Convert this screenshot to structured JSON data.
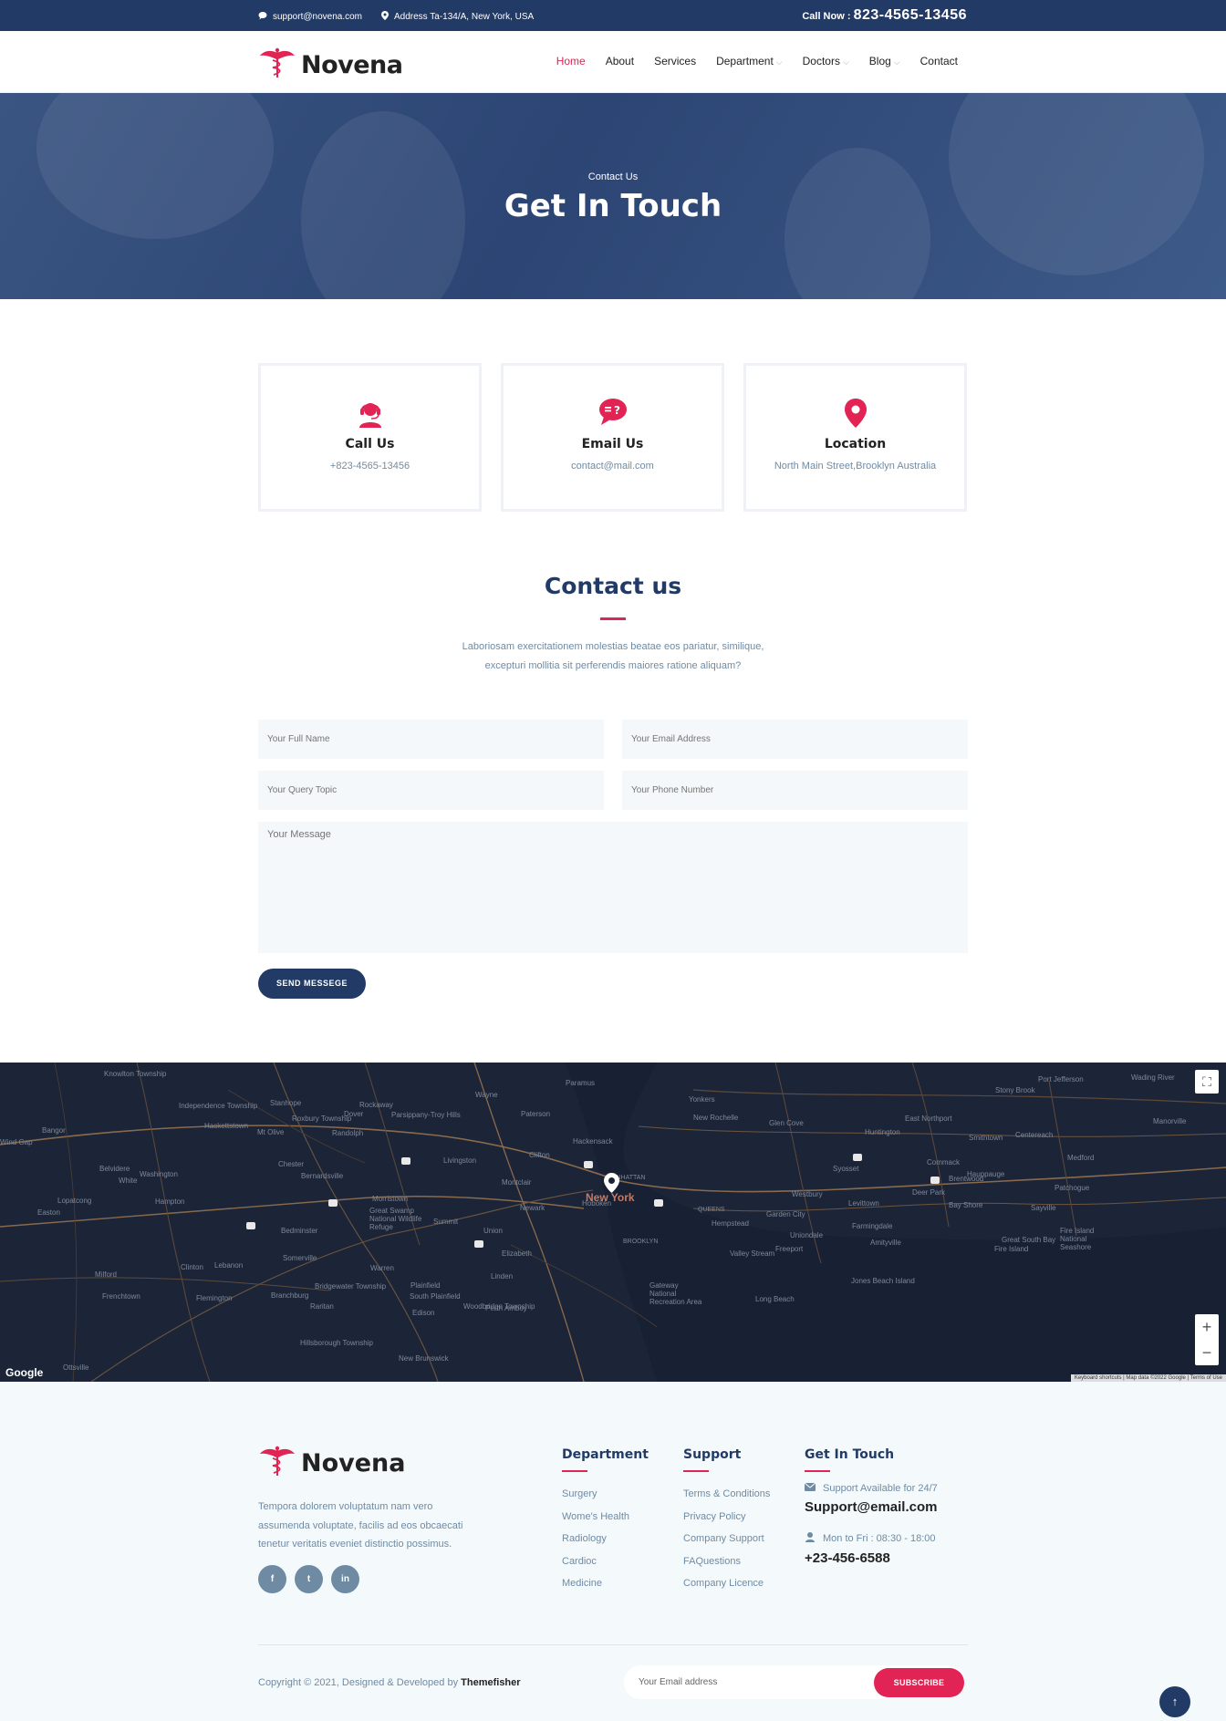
{
  "topbar": {
    "email": "support@novena.com",
    "address": "Address Ta-134/A, New York, USA",
    "call_label": "Call Now : ",
    "call_number": "823-4565-13456"
  },
  "brand": {
    "name": "Novena",
    "accent": "#e12454",
    "primary": "#223a66"
  },
  "nav": {
    "home": "Home",
    "about": "About",
    "services": "Services",
    "department": "Department",
    "doctors": "Doctors",
    "blog": "Blog",
    "contact": "Contact"
  },
  "hero": {
    "subtitle": "Contact Us",
    "title": "Get In Touch"
  },
  "cards": [
    {
      "icon": "headset-icon",
      "title": "Call Us",
      "text": "+823-4565-13456"
    },
    {
      "icon": "chat-question-icon",
      "title": "Email Us",
      "text": "contact@mail.com"
    },
    {
      "icon": "location-pin-icon",
      "title": "Location",
      "text": "North Main Street,Brooklyn Australia"
    }
  ],
  "contact": {
    "title": "Contact us",
    "desc_line1": "Laboriosam exercitationem molestias beatae eos pariatur, similique,",
    "desc_line2": "excepturi mollitia sit perferendis maiores ratione aliquam?",
    "name_placeholder": "Your Full Name",
    "email_placeholder": "Your Email Address",
    "topic_placeholder": "Your Query Topic",
    "phone_placeholder": "Your Phone Number",
    "message_placeholder": "Your Message",
    "send_label": "SEND MESSEGE"
  },
  "map": {
    "city": "New York",
    "google": "Google",
    "attribution": "Keyboard shortcuts | Map data ©2022 Google | Terms of Use",
    "labels": [
      "Yonkers",
      "New Rochelle",
      "Paterson",
      "Hackensack",
      "Clifton",
      "Montclair",
      "Morristown",
      "Newark",
      "Elizabeth",
      "Union",
      "Summit",
      "Plainfield",
      "Linden",
      "MANHATTAN",
      "QUEENS",
      "BROOKLYN",
      "Hempstead",
      "Garden City",
      "Freeport",
      "Long Beach",
      "Levittown",
      "Huntington",
      "Smithtown",
      "Centereach",
      "Medford",
      "Patchogue",
      "Bay Shore",
      "Fire Island",
      "Bedminster",
      "Somerville",
      "Edison",
      "Perth Amboy",
      "Hoboken",
      "Valley Stream",
      "Westbury",
      "Syosset",
      "Commack",
      "Hauppauge",
      "Stony Brook",
      "Port Jefferson",
      "Wading River",
      "Manorville",
      "Glen Cove",
      "East Northport",
      "Brentwood",
      "Deer Park",
      "Sayville",
      "Amityville",
      "Farmingdale",
      "Uniondale",
      "Jones Beach Island",
      "Gateway National Recreation Area",
      "Great Swamp National Wildlife Refuge",
      "Fire Island National Seashore",
      "Hackettstown",
      "Washington",
      "Hampton",
      "Clinton",
      "Flemington",
      "Milford",
      "Frenchtown",
      "Lopatcong",
      "Easton",
      "Chester",
      "Bernardsville",
      "Randolph",
      "Dover",
      "Rockaway",
      "Wayne",
      "Paramus",
      "Stanhope",
      "Roxbury Township",
      "Mt Olive",
      "Independence Township",
      "Belvidere",
      "White",
      "Knowlton Township",
      "Bangor",
      "Wind Gap",
      "Branchburg",
      "Raritan",
      "Bridgewater Township",
      "South Plainfield",
      "Woodbridge Township",
      "New Brunswick",
      "Hillsborough Township",
      "Ottsville",
      "Lebanon",
      "Warren",
      "Livingston",
      "Parsippany-Troy Hills",
      "Great South Bay"
    ]
  },
  "footer": {
    "about": "Tempora dolorem voluptatum nam vero assumenda voluptate, facilis ad eos obcaecati tenetur veritatis eveniet distinctio possimus.",
    "department_title": "Department",
    "department_links": [
      "Surgery",
      "Wome's Health",
      "Radiology",
      "Cardioc",
      "Medicine"
    ],
    "support_title": "Support",
    "support_links": [
      "Terms & Conditions",
      "Privacy Policy",
      "Company Support",
      "FAQuestions",
      "Company Licence"
    ],
    "git_title": "Get In Touch",
    "support_avail": "Support Available for 24/7",
    "support_email": "Support@email.com",
    "hours": "Mon to Fri : 08:30 - 18:00",
    "phone": "+23-456-6588",
    "copyright": "Copyright © 2021, Designed & Developed by ",
    "copyright_brand": "Themefisher",
    "subscribe_placeholder": "Your Email address",
    "subscribe_label": "SUBSCRIBE",
    "social": [
      "f",
      "t",
      "in"
    ]
  },
  "to_top": "↑"
}
